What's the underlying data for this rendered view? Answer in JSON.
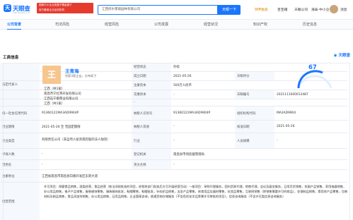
{
  "header": {
    "logo_glyph": "天",
    "logo_name": "天眼查",
    "logo_url": "TianYanCha.com",
    "banner_line1": "国家中小企业发展子基金旗下",
    "banner_line2": "官方备案企业征信机构",
    "search_value": "江西优尔景观园林有限公司",
    "search_button": "天眼一下",
    "nav_vip": "VIP会员",
    "nav_items": [
      "百宝箱",
      "天眼公司",
      "海泰·中小企",
      "消息"
    ]
  },
  "tabs": [
    "公司背景",
    "司法风险",
    "经营风险",
    "公司发展",
    "经营状况",
    "知识产权",
    "历史信息"
  ],
  "section": {
    "title": "工商信息",
    "brand_right": "天眼查",
    "score_label": "天眼评分",
    "score_value": "67"
  },
  "legal_rep": {
    "label": "法定代表人",
    "avatar_char": "王",
    "name": "王青海",
    "sub": "任职3家企业，分布如下",
    "more_line1": "江西（共1家）",
    "more_line2": "南昌市宁红茶开发有限公司",
    "more_line3": "江西石宁都茶业有限公司",
    "more_line4": "江西（共1家）"
  },
  "table": {
    "r1": {
      "l1": "经营状态",
      "v1": "存续"
    },
    "r2": {
      "l1": "成立日期",
      "v1": "2021-05-26"
    },
    "r3": {
      "l1": "注册资本",
      "v1": "500万人民币"
    },
    "r4": {
      "l1": "实缴资本",
      "v1": "-"
    },
    "r5": {
      "l1": "统一社会信用代码",
      "v1": "91360121MA3AD9904P",
      "l2": "纳税人识别号",
      "v2": "91360121MA3AD9904P",
      "l3": "组织机构代码",
      "v3": "MA3AD9904"
    },
    "r6": {
      "l1": "营业期限",
      "v1": "2021-05-26 至 无固定期限",
      "l2": "纳税人资质",
      "v2": "-",
      "l3": "核准日期",
      "v3": "2021-05-26"
    },
    "r7": {
      "l1": "企业类型",
      "v1": "有限责任公司（非自然人投资或控股的法人独资）",
      "l2": "行业",
      "v2": "-",
      "l3": "人员规模",
      "v3": "-"
    },
    "r8": {
      "l1": "参保人数",
      "v1": "-",
      "l2": "登记机关",
      "v2": "南昌县市场监督管理局"
    },
    "r9": {
      "l1": "曾用名",
      "v1": "-",
      "l2": "英文名称",
      "v2": "-"
    },
    "r10": {
      "l1": "注册地址",
      "v1": "江西省南昌市南昌县向塘开发区东新大道"
    },
    "r11": {
      "l1": "经营范围",
      "v1": "许可项目：保健食品销售，酒类经营，食品经营（依法须经批准的项目，经相关部门批准后方可开展经营活动）一般项目：采购代理服务，国内贸易代理，销售代理，会议及展览服务，日用百货销售，农副产品销售，家用电器销售，办公用品销售，电子产品销售，服装服饰零售，服装服饰批发，鞋帽零售，鞋帽批发，针纺织品销售，五金产品零售，体育用品及器材零售，化妆品零售，互联网销售（除销售需要许可的商品），金银制品销售，食用农产品零售，包装材料及制品销售，食品添加剂销售，办公用品销售，日用品销售，企业管理咨询，普通货物仓储服务（不含危险化学品等需许可审批的项目），信息咨询服务（不含许可类信息咨询服务）"
    },
    "blank_label": "-",
    "tyc_id_label": "天眼编号",
    "tyc_id": "2021111000013487"
  }
}
